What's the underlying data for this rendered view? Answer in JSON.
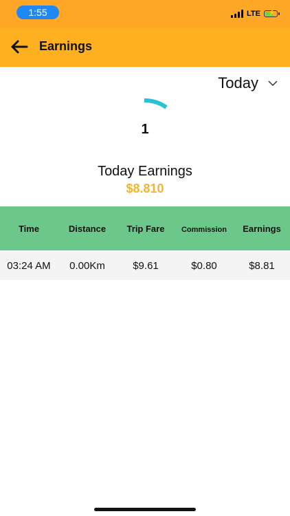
{
  "status_bar": {
    "time": "1:55",
    "network": "LTE",
    "colors": {
      "background": "#FFA726",
      "time_pill": "#1E88F5",
      "battery": "#6ED13E"
    },
    "icons": [
      "signal-icon",
      "battery-charging-icon"
    ]
  },
  "header": {
    "title": "Earnings",
    "back_icon": "arrow-left-icon",
    "background": "#FFB020"
  },
  "period": {
    "selected": "Today",
    "icon": "chevron-down-icon"
  },
  "summary": {
    "count": "1",
    "label": "Today Earnings",
    "total": "$8.810",
    "total_color": "#F2B533",
    "spinner_color": "#2BC0D6"
  },
  "table": {
    "header_background": "#6CC88A",
    "columns": [
      "Time",
      "Distance",
      "Trip Fare",
      "Commission",
      "Earnings"
    ],
    "rows": [
      [
        "03:24 AM",
        "0.00Km",
        "$9.61",
        "$0.80",
        "$8.81"
      ]
    ]
  }
}
